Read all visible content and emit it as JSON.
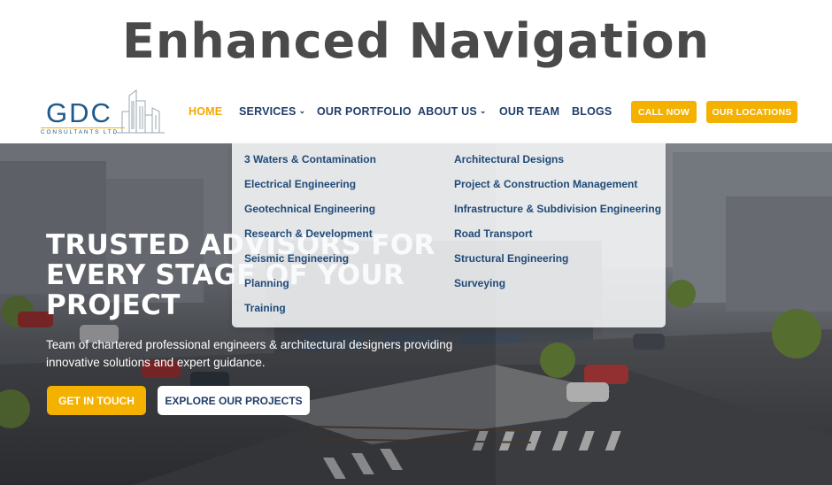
{
  "heading": "Enhanced Navigation",
  "logo": {
    "text": "GDC",
    "subtext": "CONSULTANTS LTD"
  },
  "nav": {
    "home": "HOME",
    "services": "SERVICES",
    "portfolio": "OUR PORTFOLIO",
    "about": "ABOUT US",
    "team": "OUR TEAM",
    "blogs": "BLOGS",
    "call_now": "CALL NOW",
    "locations": "OUR LOCATIONS",
    "chevron": "⌄"
  },
  "services_menu": {
    "left": [
      "3 Waters & Contamination",
      "Electrical Engineering",
      "Geotechnical Engineering",
      "Research & Development",
      "Seismic Engineering",
      "Planning",
      "Training"
    ],
    "right": [
      "Architectural Designs",
      "Project & Construction Management",
      "Infrastructure & Subdivision Engineering",
      "Road Transport",
      "Structural Engineering",
      "Surveying"
    ]
  },
  "hero": {
    "title": "TRUSTED ADVISORS FOR EVERY STAGE OF YOUR PROJECT",
    "subtitle": "Team of chartered professional engineers & architectural designers providing innovative solutions and expert guidance.",
    "cta_primary": "GET IN TOUCH",
    "cta_secondary": "EXPLORE OUR PROJECTS"
  },
  "colors": {
    "accent": "#f5b100",
    "navy": "#1f3e6a",
    "heading": "#4a4a4a"
  }
}
